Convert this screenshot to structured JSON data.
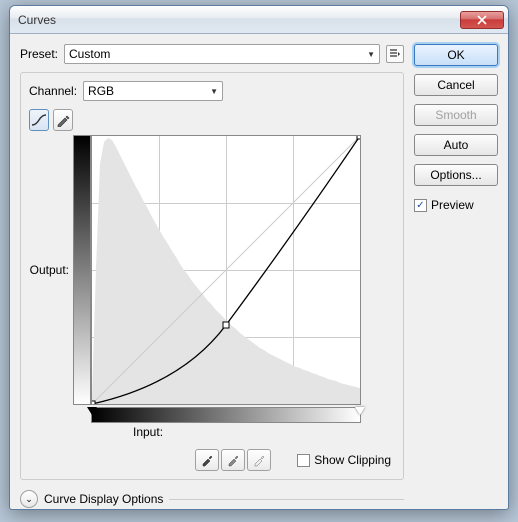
{
  "window": {
    "title": "Curves"
  },
  "preset": {
    "label": "Preset:",
    "value": "Custom"
  },
  "channel": {
    "label": "Channel:",
    "value": "RGB"
  },
  "axes": {
    "output": "Output:",
    "input": "Input:"
  },
  "show_clipping": {
    "label": "Show Clipping",
    "checked": false
  },
  "curve_options": {
    "label": "Curve Display Options"
  },
  "buttons": {
    "ok": "OK",
    "cancel": "Cancel",
    "smooth": "Smooth",
    "auto": "Auto",
    "options": "Options..."
  },
  "preview": {
    "label": "Preview",
    "checked": true
  },
  "icons": {
    "preset_menu": "preset-menu-icon",
    "curve_tool": "curve-tool-icon",
    "pencil_tool": "pencil-tool-icon",
    "close": "close-icon",
    "expand": "expand-icon",
    "eyedropper_black": "black-point-eyedropper",
    "eyedropper_gray": "gray-point-eyedropper",
    "eyedropper_white": "white-point-eyedropper"
  },
  "chart_data": {
    "type": "line",
    "title": "Tone Curve",
    "xlabel": "Input",
    "ylabel": "Output",
    "xlim": [
      0,
      255
    ],
    "ylim": [
      0,
      255
    ],
    "baseline": [
      [
        0,
        0
      ],
      [
        255,
        255
      ]
    ],
    "curve_points": [
      [
        0,
        0
      ],
      [
        128,
        75
      ],
      [
        255,
        255
      ]
    ],
    "control_points": [
      [
        0,
        0
      ],
      [
        128,
        75
      ],
      [
        255,
        255
      ]
    ],
    "histogram_x_step": 4,
    "histogram": [
      8,
      130,
      230,
      250,
      255,
      252,
      245,
      238,
      230,
      222,
      214,
      207,
      199,
      192,
      185,
      178,
      171,
      165,
      158,
      152,
      146,
      140,
      134,
      129,
      123,
      118,
      113,
      108,
      103,
      99,
      94,
      90,
      86,
      82,
      78,
      75,
      71,
      68,
      65,
      62,
      59,
      56,
      53,
      51,
      48,
      46,
      44,
      42,
      40,
      38,
      36,
      34,
      33,
      31,
      30,
      28,
      27,
      26,
      24,
      23,
      22,
      21,
      20,
      18
    ],
    "grid_divisions": 4
  }
}
